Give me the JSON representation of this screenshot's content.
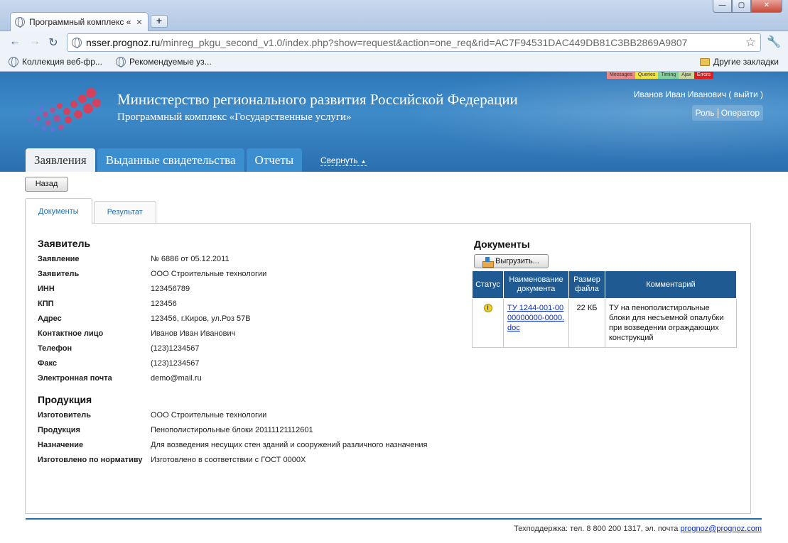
{
  "browser": {
    "tab_title": "Программный комплекс «",
    "url_host": "nsser.prognoz.ru",
    "url_path": "/minreg_pkgu_second_v1.0/index.php?show=request&action=one_req&rid=AC7F94531DAC449DB81C3BB2869A9807",
    "bookmarks": [
      "Коллекция веб-фр...",
      "Рекомендуемые уз..."
    ],
    "other_bookmarks": "Другие закладки"
  },
  "debug_bar": [
    "Messages",
    "Queries",
    "Timing",
    "Ajax",
    "Errors"
  ],
  "header": {
    "ministry": "Министерство регионального развития Российской Федерации",
    "program": "Программный комплекс «Государственные услуги»",
    "user": "Иванов Иван Иванович ( выйти )",
    "role_label": "Роль",
    "role_value": "Оператор"
  },
  "nav": {
    "tabs": [
      "Заявления",
      "Выданные свидетельства",
      "Отчеты"
    ],
    "collapse": "Свернуть"
  },
  "back_button": "Назад",
  "panel_tabs": [
    "Документы",
    "Результат"
  ],
  "applicant": {
    "title": "Заявитель",
    "rows": [
      {
        "k": "Заявление",
        "v": "№ 6886 от 05.12.2011"
      },
      {
        "k": "Заявитель",
        "v": "ООО Строительные технологии"
      },
      {
        "k": "ИНН",
        "v": "123456789"
      },
      {
        "k": "КПП",
        "v": "123456"
      },
      {
        "k": "Адрес",
        "v": "123456, г.Киров, ул.Роз 57В"
      },
      {
        "k": "Контактное лицо",
        "v": "Иванов Иван Иванович"
      },
      {
        "k": "Телефон",
        "v": "(123)1234567"
      },
      {
        "k": "Факс",
        "v": "(123)1234567"
      },
      {
        "k": "Электронная почта",
        "v": "demo@mail.ru"
      }
    ]
  },
  "product": {
    "title": "Продукция",
    "rows": [
      {
        "k": "Изготовитель",
        "v": "ООО Строительные технологии"
      },
      {
        "k": "Продукция",
        "v": "Пенополистирольные блоки 20111121112601"
      },
      {
        "k": "Назначение",
        "v": "Для возведения несущих стен зданий и сооружений различного назначения"
      },
      {
        "k": "Изготовлено по нормативу",
        "v": "Изготовлено в соответствии с ГОСТ 0000Х"
      }
    ]
  },
  "documents": {
    "title": "Документы",
    "export_label": "Выгрузить...",
    "headers": [
      "Статус",
      "Наименование документа",
      "Размер файла",
      "Комментарий"
    ],
    "rows": [
      {
        "status": "!",
        "name": "ТУ 1244-001-0000000000-0000.doc",
        "size": "22 КБ",
        "comment": "ТУ на пенополистирольные блоки для несъемной опалубки при возведении ограждающих конструкций"
      }
    ]
  },
  "footer": {
    "support": "Техподдержка: тел. 8 800 200 1317, эл. почта",
    "email": "prognoz@prognoz.com"
  },
  "colors": {
    "header_blue": "#2d77b8",
    "table_header": "#1f5a93",
    "link": "#0a2ccf"
  }
}
